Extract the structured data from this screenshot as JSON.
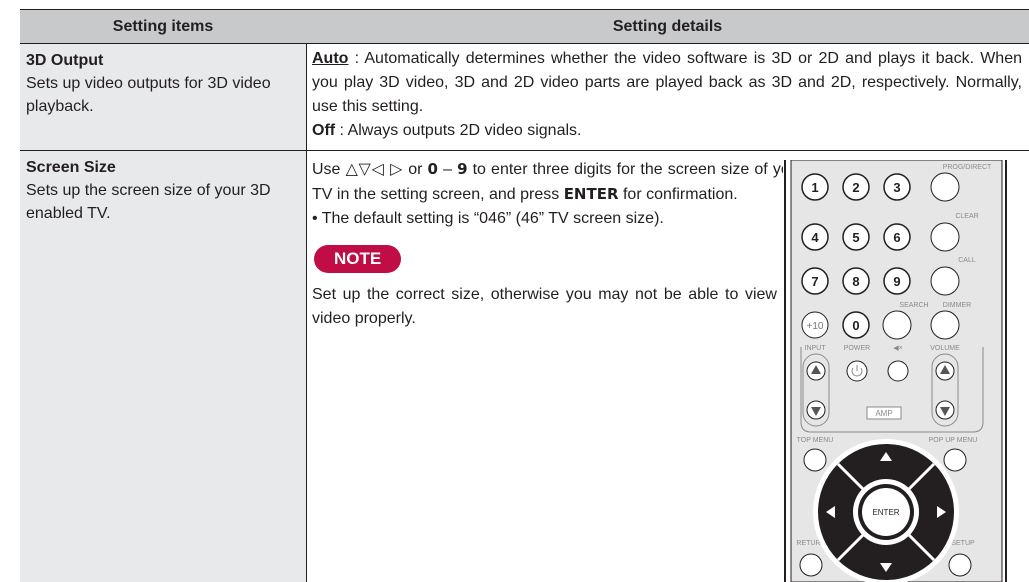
{
  "header": {
    "col1": "Setting items",
    "col2": "Setting details"
  },
  "rows": [
    {
      "title": "3D Output",
      "desc": "Sets up video outputs for 3D video playback.",
      "details": {
        "auto_label": "Auto",
        "auto_text": " : Automatically determines whether the video software is 3D or 2D and plays it back. When you play 3D video, 3D and 2D video parts are played back as 3D and 2D, respectively. Normally, use this setting.",
        "off_label": "Off",
        "off_text": " : Always outputs 2D video signals."
      }
    },
    {
      "title": "Screen Size",
      "desc": "Sets up the screen size of your 3D enabled TV.",
      "details": {
        "p1_a": "Use ",
        "arrows": "△▽◁ ▷",
        "p1_b": " or ",
        "key0": "0",
        "dash": " – ",
        "key9": "9",
        "p1_c": " to enter three digits for the screen size of your TV in the setting screen, and press ",
        "enter": "ENTER",
        "p1_d": " for confirmation.",
        "bullet": "• The default setting is “046” (46” TV screen size).",
        "note_label": "NOTE",
        "note_text": "Set up the correct size, otherwise you may not be able to view 3D video properly."
      }
    }
  ],
  "remote": {
    "labels": {
      "prog": "PROG/DIRECT",
      "clear": "CLEAR",
      "call": "CALL",
      "search": "SEARCH",
      "dimmer": "DIMMER",
      "input": "INPUT",
      "power": "POWER",
      "mute": "◀×",
      "volume": "VOLUME",
      "amp": "AMP",
      "top_menu": "TOP MENU",
      "popup_menu": "POP UP MENU",
      "return": "RETURN",
      "setup": "SETUP",
      "enter": "ENTER"
    },
    "digits": [
      "1",
      "2",
      "3",
      "4",
      "5",
      "6",
      "7",
      "8",
      "9",
      "+10",
      "0"
    ]
  },
  "colors": {
    "header_bg": "#c8c9ca",
    "label_bg": "#e8e9ea",
    "note_bg": "#c00d45",
    "remote_bg": "#e6e6e6"
  }
}
